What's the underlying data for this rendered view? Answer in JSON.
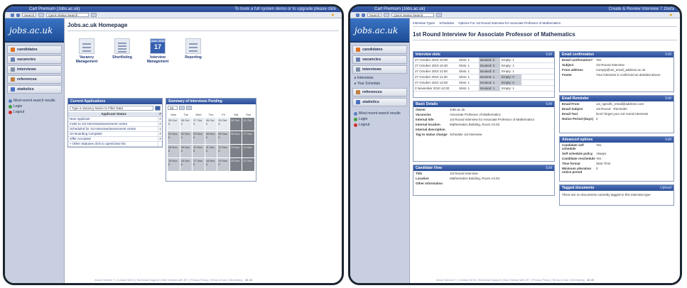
{
  "browser": {
    "title": "Cart Premium (Jobs.ac.uk)",
    "title2": "Cart Premium (Jobs.ac.uk)",
    "notice": "To book a full system demo or to upgrade please click",
    "notice2": "Create & Review Interview 7.1beta",
    "search": "Search",
    "quick_search": "Quick Status Search"
  },
  "logo": "jobs.ac.uk",
  "nav": [
    "candidates",
    "vacancies",
    "interviews",
    "references",
    "statistics"
  ],
  "subnav": [
    "Interviews",
    "Your Schedule"
  ],
  "links": [
    "Most recent search results",
    "Login",
    "Logout"
  ],
  "footer": "About Version 7 | Contact WCN | Technical Support | Best Viewed with IE7 | Privacy Policy | Terms of Use | Monitoring",
  "footer_num": "28 28",
  "footer_num2": "28 45",
  "home": {
    "title": "Jobs.ac.uk Homepage",
    "quick": [
      {
        "label": "Vacancy Management"
      },
      {
        "label": "Shortlisting"
      },
      {
        "label": "Interview Management",
        "cal_top": "June 2010",
        "cal_day": "17"
      },
      {
        "label": "Reporting"
      }
    ],
    "apps_title": "Current Applications",
    "apps_input": "Type a Vacancy Name to Filter Data",
    "apps_header": "Applicant Status",
    "apps_header_n": "#",
    "apps": [
      {
        "status": "New Applicant",
        "n": "2"
      },
      {
        "status": "Invite to 1st Interview/assessment centre",
        "n": "2"
      },
      {
        "status": "Scheduled for 1st Interview/assessment centre",
        "n": "1"
      },
      {
        "status": "On Boarding Complete",
        "n": "2"
      },
      {
        "status": "Offer Accepted",
        "n": "2"
      },
      {
        "status": "+ Other Statuses click to open/close list",
        "n": ""
      }
    ],
    "sum_title": "Summary of Interviews Pending",
    "sum_select": "28",
    "days": [
      "Mon",
      "Tue",
      "Wed",
      "Thu",
      "Fri",
      "Sat",
      "Sun"
    ],
    "cal": [
      [
        "25 Oct 0",
        "26 Oct 2",
        "27 Oct 0",
        "28 Oct 0",
        "29 Oct 0",
        "30 Oct",
        "31 Oct"
      ],
      [
        "01 Nov 0",
        "02 Nov 0",
        "03 Nov 0",
        "04 Nov 0",
        "05 Nov 0",
        "06 Nov",
        "07 Nov"
      ],
      [
        "08 Nov 0",
        "09 Nov 0",
        "10 Nov 0",
        "11 Nov 0",
        "12 Nov 0",
        "13 Nov",
        "14 Nov"
      ],
      [
        "15 Nov 0",
        "16 Nov 0",
        "17 Nov 0",
        "18 Nov 0",
        "19 Nov 0",
        "20 Nov",
        "21 Nov"
      ]
    ]
  },
  "interview": {
    "tabs": [
      "Interview Types",
      "Schedules",
      "Options For 1st Round Interview for Associate Professor of Mathematics"
    ],
    "title": "1st Round Interview for Associate Professor of Mathematics",
    "edit": "Edit",
    "upload": "Upload",
    "slots_title": "Interview slots",
    "slots": [
      {
        "t": "27 October 2010 10:00",
        "s": "Slots: 1",
        "b": "Booked: 0",
        "e": "Empty: 1"
      },
      {
        "t": "27 October 2010 10:30",
        "s": "Slots: 1",
        "b": "Booked: 0",
        "e": "Empty: 1"
      },
      {
        "t": "27 October 2010 11:00",
        "s": "Slots: 1",
        "b": "Booked: 0",
        "e": "Empty: 1"
      },
      {
        "t": "27 October 2010 11:30",
        "s": "Slots: 1",
        "b": "Booked: 1",
        "e": "Empty: 0"
      },
      {
        "t": "27 October 2010 12:00",
        "s": "Slots: 1",
        "b": "Booked: 1",
        "e": "Empty: 0"
      },
      {
        "t": "2 November 2010 12:30",
        "s": "Slots: 1",
        "b": "Booked: 1",
        "e": "Empty: 1"
      }
    ],
    "basic_title": "Basic Details",
    "basic": [
      {
        "k": "Owner",
        "v": "Jobs.ac.uk"
      },
      {
        "k": "Vacancies",
        "v": "Associate Professor of Mathematics"
      },
      {
        "k": "Internal title",
        "v": "1st Round Interview for Associate Professor of Mathematics"
      },
      {
        "k": "Internal location",
        "v": "Mathematics Building, Room A3.03"
      },
      {
        "k": "Internal description",
        "v": ""
      },
      {
        "k": "Tag to status change",
        "v": "Schedule 1st Interview"
      }
    ],
    "cand_title": "Candidate View",
    "cand": [
      {
        "k": "Title",
        "v": "1st Round Interview"
      },
      {
        "k": "Location",
        "v": "Mathematics Building, Room A3.03"
      },
      {
        "k": "Other information",
        "v": ""
      }
    ],
    "email_title": "Email confirmation",
    "email": [
      {
        "k": "Email confirmation?",
        "v": "Yes"
      },
      {
        "k": "Subject",
        "v": "1st Round Interview"
      },
      {
        "k": "From address",
        "v": "noreply@uni_email_address.ac.uk"
      },
      {
        "k": "Footer",
        "v": "Your interview is confirmed as detailed above."
      }
    ],
    "rem_title": "Email Reminder",
    "rem": [
      {
        "k": "Email From",
        "v": "uni_specific_email@address.com"
      },
      {
        "k": "Email Subject",
        "v": "1st Round - Reminder"
      },
      {
        "k": "Email Text",
        "v": "Don't forget your 1st round interview!"
      },
      {
        "k": "Notice Period (Days)",
        "v": "2"
      }
    ],
    "adv_title": "Advanced options",
    "adv": [
      {
        "k": "Candidate self schedule",
        "v": "Yes"
      },
      {
        "k": "Self schedule policy",
        "v": "Always"
      },
      {
        "k": "Candidate reschedule",
        "v": "Yes"
      },
      {
        "k": "Time format",
        "v": "Start Time"
      },
      {
        "k": "Minimum alteration notice period",
        "v": "0"
      }
    ],
    "docs_title": "Tagged documents",
    "docs_text": "There are no documents currently tagged to this interview type"
  }
}
